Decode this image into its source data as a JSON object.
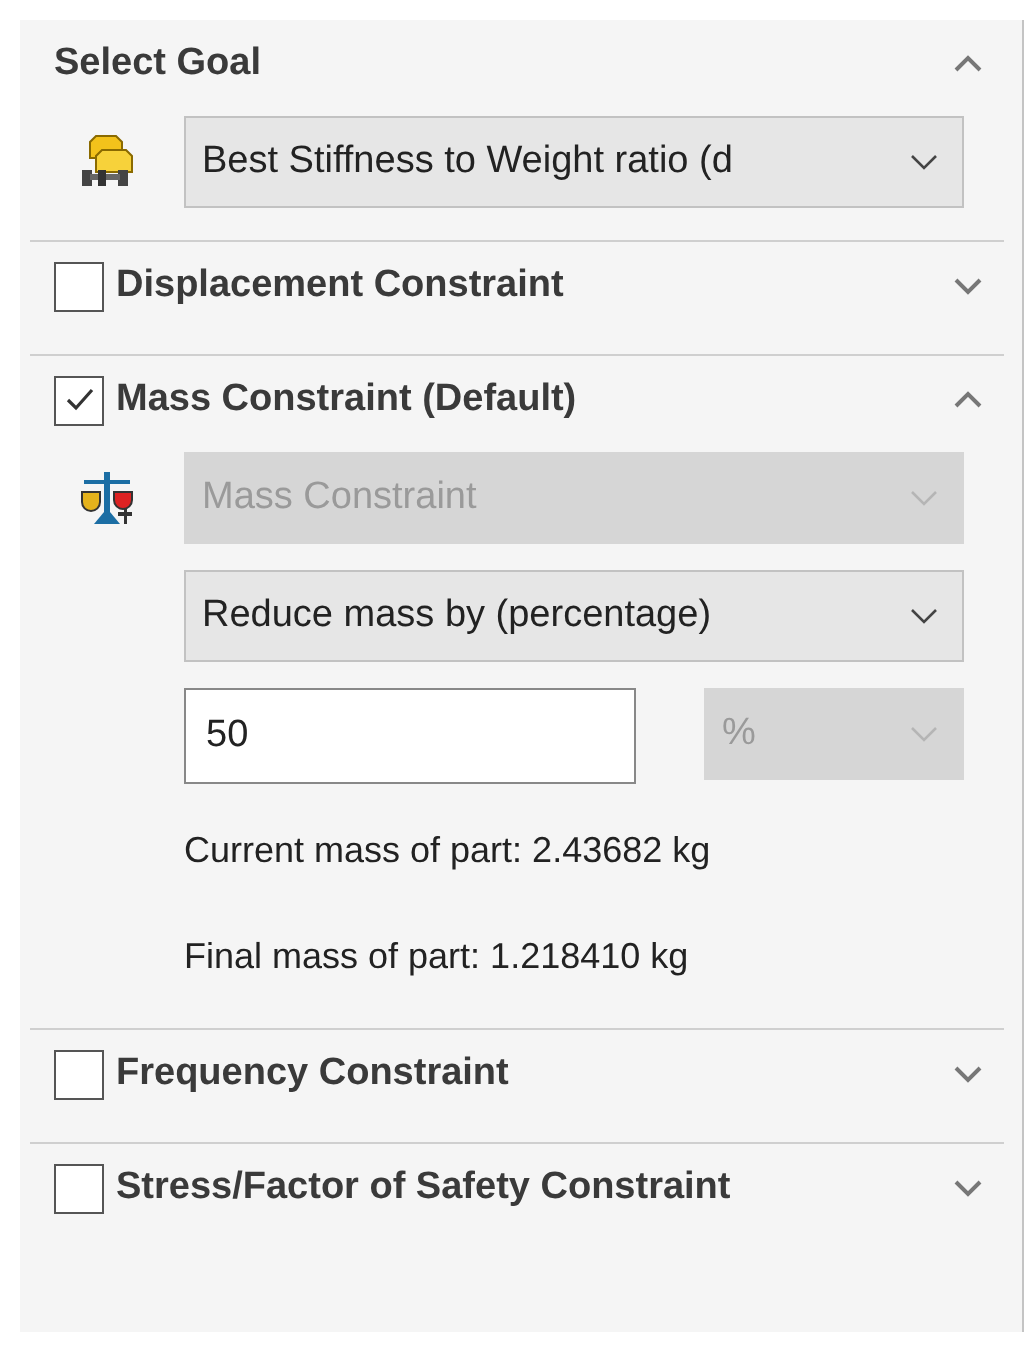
{
  "sections": [
    {
      "kind": "goal",
      "title": "Select Goal",
      "expanded": true,
      "rows": [
        {
          "kind": "dropdown",
          "value": "Best Stiffness to Weight ratio (d",
          "disabled": false
        }
      ]
    },
    {
      "kind": "constraint",
      "title": "Displacement Constraint",
      "checked": false,
      "expanded": false
    },
    {
      "kind": "constraint",
      "title": "Mass Constraint (Default)",
      "checked": true,
      "expanded": true,
      "rows": [
        {
          "kind": "dropdown",
          "value": "Mass Constraint",
          "disabled": true
        },
        {
          "kind": "dropdown",
          "value": "Reduce mass by (percentage)",
          "disabled": false
        },
        {
          "kind": "field-unit",
          "value": "50",
          "unit": "%",
          "unit_disabled": true
        },
        {
          "kind": "text",
          "text": "Current mass of part: 2.43682 kg"
        },
        {
          "kind": "text",
          "text": "Final mass of part: 1.218410 kg"
        }
      ]
    },
    {
      "kind": "constraint",
      "title": "Frequency Constraint",
      "checked": false,
      "expanded": false
    },
    {
      "kind": "constraint",
      "title": "Stress/Factor of Safety Constraint",
      "checked": false,
      "expanded": false
    }
  ]
}
